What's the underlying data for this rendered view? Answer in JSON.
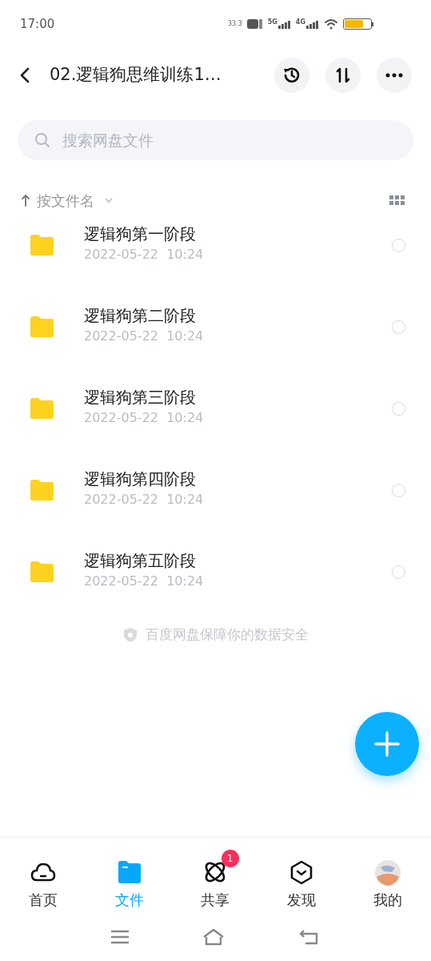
{
  "status_bar": {
    "time": "17:00",
    "net_speed": "33.3",
    "network_labels": [
      "5G",
      "4G"
    ],
    "battery": {
      "level": 0.72
    }
  },
  "header": {
    "title": "02.逻辑狗思维训练1…"
  },
  "search": {
    "placeholder": "搜索网盘文件"
  },
  "sort": {
    "label": "按文件名"
  },
  "files": [
    {
      "name": "逻辑狗第一阶段",
      "date": "2022-05-22  10:24",
      "selected": false
    },
    {
      "name": "逻辑狗第二阶段",
      "date": "2022-05-22  10:24",
      "selected": false
    },
    {
      "name": "逻辑狗第三阶段",
      "date": "2022-05-22  10:24",
      "selected": false
    },
    {
      "name": "逻辑狗第四阶段",
      "date": "2022-05-22  10:24",
      "selected": false
    },
    {
      "name": "逻辑狗第五阶段",
      "date": "2022-05-22  10:24",
      "selected": false
    }
  ],
  "security_note": "百度网盘保障你的数据安全",
  "tabs": [
    {
      "kind": "home",
      "label": "首页",
      "selected": false
    },
    {
      "kind": "files",
      "label": "文件",
      "selected": true
    },
    {
      "kind": "share",
      "label": "共享",
      "selected": false,
      "badge": "1"
    },
    {
      "kind": "discover",
      "label": "发现",
      "selected": false
    },
    {
      "kind": "me",
      "label": "我的",
      "selected": false
    }
  ]
}
